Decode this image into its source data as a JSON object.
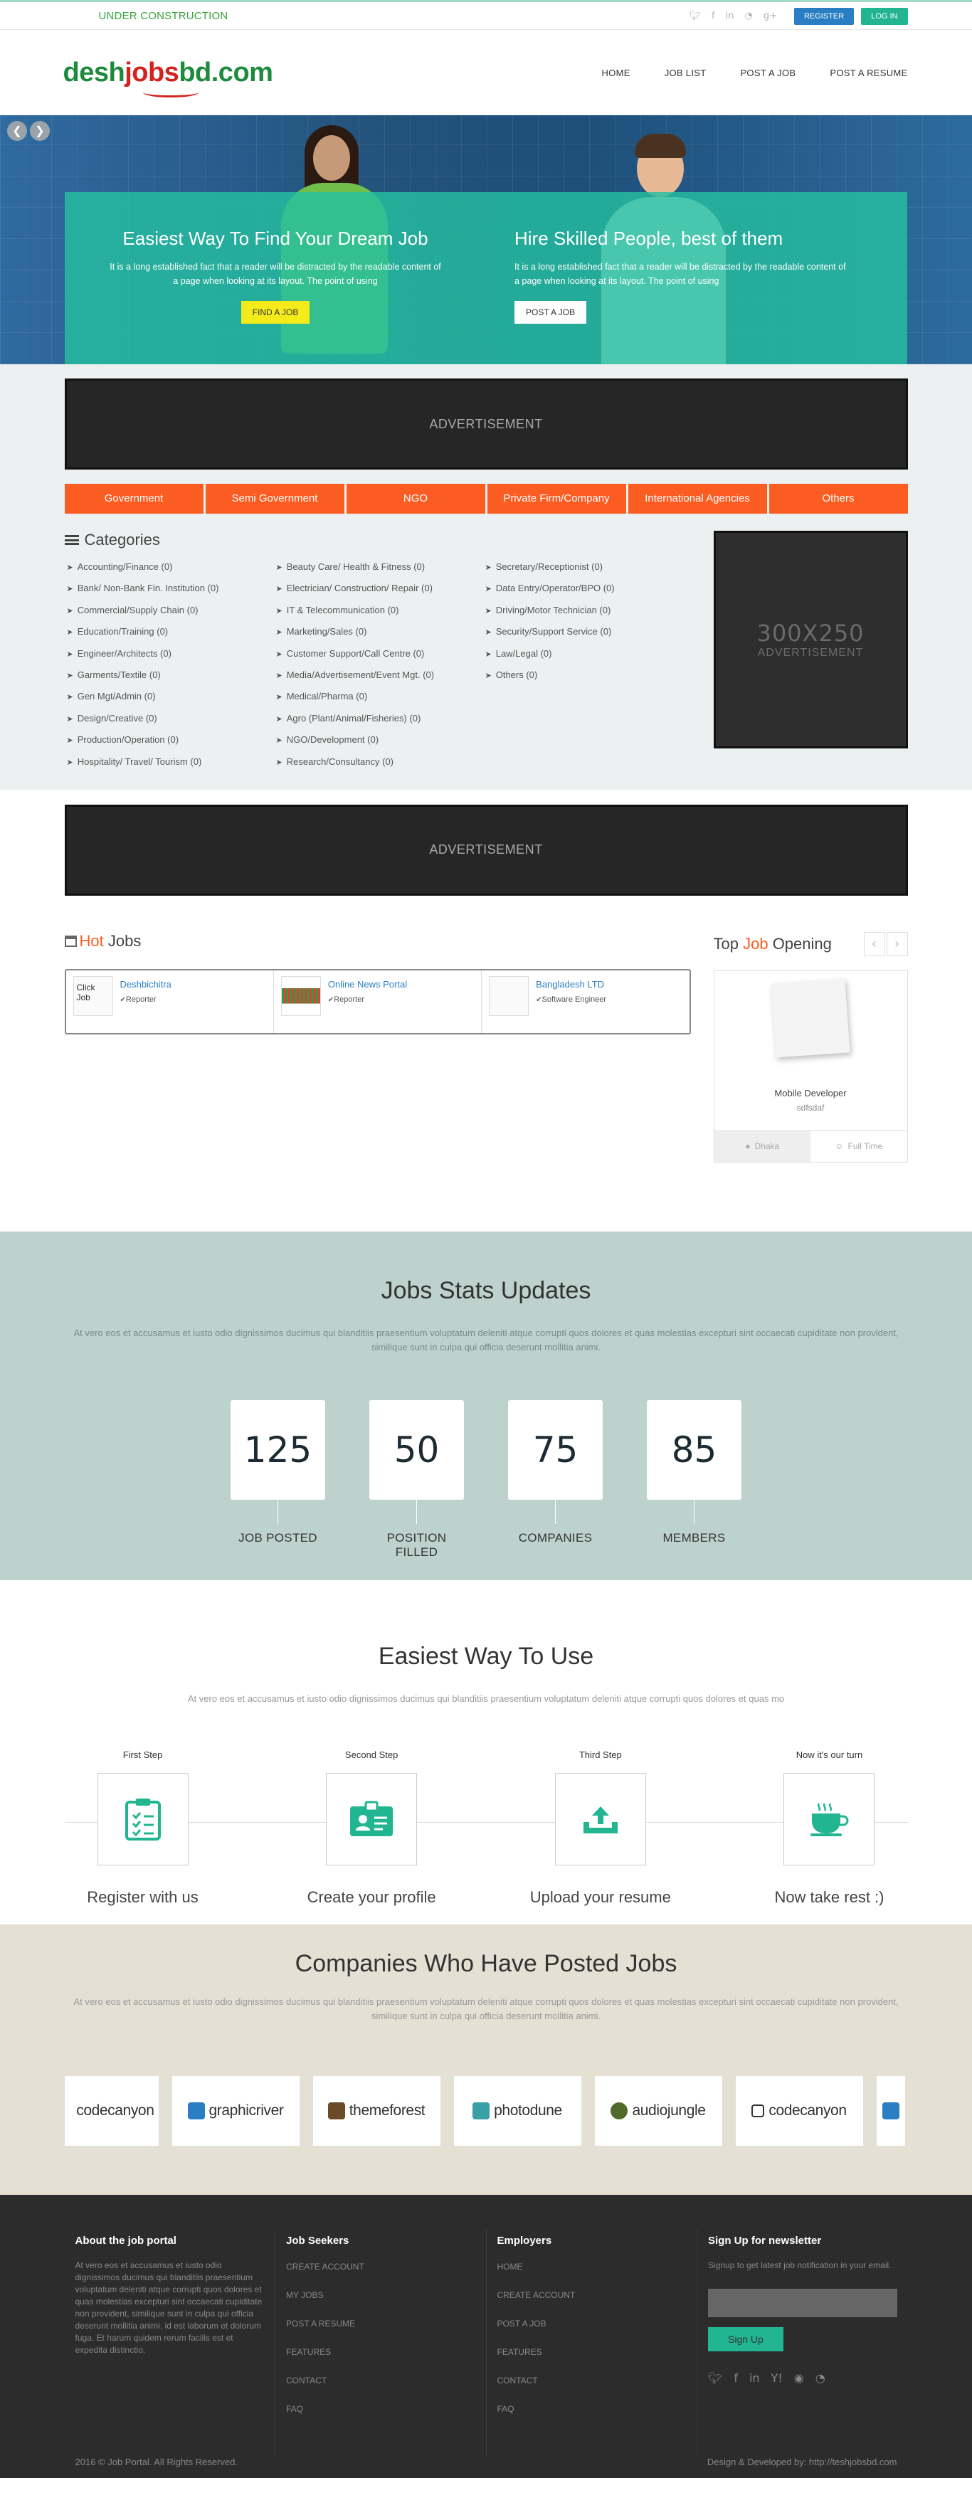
{
  "topbar": {
    "under_construction": "UNDER CONSTRUCTION",
    "register": "REGISTER",
    "login": "LOG IN"
  },
  "header": {
    "logo_a": "desh",
    "logo_b": "jobs",
    "logo_c": "bd.com",
    "nav": [
      "HOME",
      "JOB LIST",
      "POST A JOB",
      "POST A RESUME"
    ]
  },
  "hero": {
    "left_title": "Easiest Way To Find Your Dream Job",
    "left_text": "It is a long established fact that a reader will be distracted by the readable content of a page when looking at its layout. The point of using",
    "left_button": "FIND A JOB",
    "right_title": "Hire Skilled People, best of them",
    "right_text": "It is a long established fact that a reader will be distracted by the readable content of a page when looking at its layout. The point of using",
    "right_button": "POST A JOB"
  },
  "ad_text": "ADVERTISEMENT",
  "category_tabs": [
    "Government",
    "Semi Government",
    "NGO",
    "Private Firm/Company",
    "International Agencies",
    "Others"
  ],
  "categories": {
    "title": "Categories",
    "col1": [
      "Accounting/Finance (0)",
      "Bank/ Non-Bank Fin. Institution (0)",
      "Commercial/Supply Chain (0)",
      "Education/Training (0)",
      "Engineer/Architects (0)",
      "Garments/Textile (0)",
      "Gen Mgt/Admin (0)",
      "Design/Creative (0)",
      "Production/Operation (0)",
      "Hospitality/ Travel/ Tourism (0)"
    ],
    "col2": [
      "Beauty Care/ Health & Fitness (0)",
      "Electrician/ Construction/ Repair (0)",
      "IT & Telecommunication (0)",
      "Marketing/Sales (0)",
      "Customer Support/Call Centre (0)",
      "Media/Advertisement/Event Mgt. (0)",
      "Medical/Pharma (0)",
      "Agro (Plant/Animal/Fisheries) (0)",
      "NGO/Development (0)",
      "Research/Consultancy (0)"
    ],
    "col3": [
      "Secretary/Receptionist (0)",
      "Data Entry/Operator/BPO (0)",
      "Driving/Motor Technician (0)",
      "Security/Support Service (0)",
      "Law/Legal (0)",
      "Others (0)"
    ]
  },
  "ad300": {
    "size": "300X250",
    "label": "ADVERTISEMENT"
  },
  "hot_jobs": {
    "title_a": "Hot",
    "title_b": " Jobs",
    "items": [
      {
        "thumb": "Click Job",
        "company": "Deshbichitra",
        "position": "Reporter"
      },
      {
        "thumb": "",
        "company": "Online News Portal",
        "position": "Reporter"
      },
      {
        "thumb": "",
        "company": "Bangladesh LTD",
        "position": "Software Engineer"
      }
    ]
  },
  "top_job": {
    "title_a": "Top ",
    "title_b": "Job",
    "title_c": " Opening",
    "position": "Mobile Developer",
    "company": "sdfsdaf",
    "location": "Dhaka",
    "type": "Full Time"
  },
  "stats": {
    "title": "Jobs Stats Updates",
    "text": "At vero eos et accusamus et iusto odio dignissimos ducimus qui blanditiis praesentium voluptatum deleniti atque corrupti quos dolores et quas molestias excepturi sint occaecati cupiditate non provident, similique sunt in culpa qui officia deserunt mollitia animi.",
    "counters": [
      {
        "value": "125",
        "label": "JOB POSTED"
      },
      {
        "value": "50",
        "label": "POSITION FILLED"
      },
      {
        "value": "75",
        "label": "COMPANIES"
      },
      {
        "value": "85",
        "label": "MEMBERS"
      }
    ]
  },
  "easy": {
    "title": "Easiest Way To Use",
    "text": "At vero eos et accusamus et iusto odio dignissimos ducimus qui blanditiis praesentium voluptatum deleniti atque corrupti quos dolores et quas mo",
    "steps": [
      {
        "label": "First Step",
        "title": "Register with us",
        "icon": "clipboard-icon"
      },
      {
        "label": "Second Step",
        "title": "Create your profile",
        "icon": "id-card-icon"
      },
      {
        "label": "Third Step",
        "title": "Upload your resume",
        "icon": "upload-icon"
      },
      {
        "label": "Now it's our turn",
        "title": "Now take rest :)",
        "icon": "coffee-icon"
      }
    ]
  },
  "companies": {
    "title": "Companies Who Have Posted Jobs",
    "text": "At vero eos et accusamus et iusto odio dignissimos ducimus qui blanditiis praesentium voluptatum deleniti atque corrupti quos dolores et quas molestias excepturi sint occaecati cupiditate non provident, similique sunt in culpa qui officia deserunt mollitia animi.",
    "logos": [
      "codecanyon",
      "graphicriver",
      "themeforest",
      "photodune",
      "audiojungle",
      "codecanyon"
    ]
  },
  "footer": {
    "about_title": "About the job portal",
    "about_text": "At vero eos et accusamus et iusto odio dignissimos ducimus qui blanditiis praesentium voluptatum deleniti atque corrupti quos dolores et quas molestias excepturi sint occaecati cupiditate non provident, similique sunt in culpa qui officia deserunt mollitia animi, id est laborum et dolorum fuga. Et harum quidem rerum facilis est et expedita distinctio.",
    "seekers_title": "Job Seekers",
    "seekers_links": [
      "CREATE ACCOUNT",
      "MY JOBS",
      "POST A RESUME",
      "FEATURES",
      "CONTACT",
      "FAQ"
    ],
    "employers_title": "Employers",
    "employers_links": [
      "HOME",
      "CREATE ACCOUNT",
      "POST A JOB",
      "FEATURES",
      "CONTACT",
      "FAQ"
    ],
    "newsletter_title": "Sign Up for newsletter",
    "newsletter_text": "Signup to get latest job notification in your email.",
    "signup": "Sign Up",
    "copyright": "2016 © Job Portal. All Rights Reserved.",
    "credit": "Design & Developed by: http://teshjobsbd.com"
  },
  "colors": {
    "accent": "#22b592",
    "orange": "#fb5c22",
    "blue": "#2a7fc4"
  }
}
